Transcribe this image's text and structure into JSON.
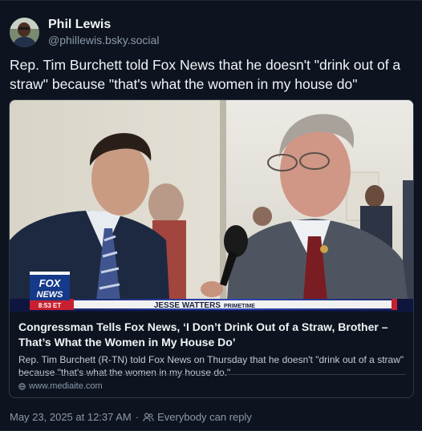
{
  "author": {
    "display_name": "Phil Lewis",
    "handle": "@phillewis.bsky.social"
  },
  "post": {
    "text": "Rep. Tim Burchett told Fox News that he doesn't \"drink out of a straw\" because \"that's what the women in my house do\""
  },
  "embed": {
    "chyron_logo_top": "FOX",
    "chyron_logo_bottom": "NEWS",
    "chyron_time": "8:53 ET",
    "chyron_show": "JESSE WATTERS",
    "chyron_show_suffix": "PRIMETIME",
    "title": "Congressman Tells Fox News, ‘I Don’t Drink Out of a Straw, Brother – That’s What the Women in My House Do’",
    "description": "Rep. Tim Burchett (R-TN) told Fox News on Thursday that he doesn't \"drink out of a straw\" because \"that's what the women in my house do.\"",
    "domain": "www.mediaite.com"
  },
  "meta": {
    "timestamp": "May 23, 2025 at 12:37 AM",
    "reply_setting": "Everybody can reply"
  }
}
